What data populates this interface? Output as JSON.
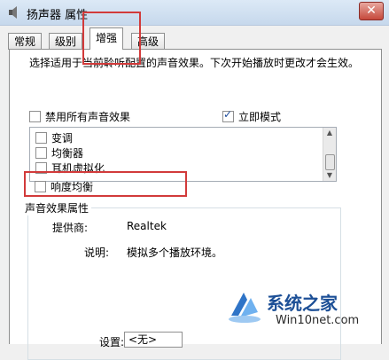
{
  "window": {
    "title": "扬声器 属性",
    "close_glyph": "✕"
  },
  "tabs": [
    {
      "label": "常规"
    },
    {
      "label": "级别"
    },
    {
      "label": "增强"
    },
    {
      "label": "高级"
    }
  ],
  "enhancement": {
    "description": "选择适用于当前聆听配置的声音效果。下次开始播放时更改才会生效。",
    "disable_all_label": "禁用所有声音效果",
    "disable_all_checked": false,
    "immediate_mode_label": "立即模式",
    "immediate_mode_checked": true,
    "effects": [
      {
        "label": "变调",
        "checked": false
      },
      {
        "label": "均衡器",
        "checked": false
      },
      {
        "label": "耳机虚拟化",
        "checked": false
      },
      {
        "label": "响度均衡",
        "checked": false
      }
    ],
    "properties": {
      "group_title": "声音效果属性",
      "provider_label": "提供商:",
      "provider_value": "Realtek",
      "description_label": "说明:",
      "description_value": "模拟多个播放环境。",
      "settings_label": "设置:",
      "settings_value": "<无>"
    }
  },
  "watermark": {
    "brand": "系统之家",
    "url": "Win10net.com"
  },
  "highlight_color": "#d23a3a"
}
